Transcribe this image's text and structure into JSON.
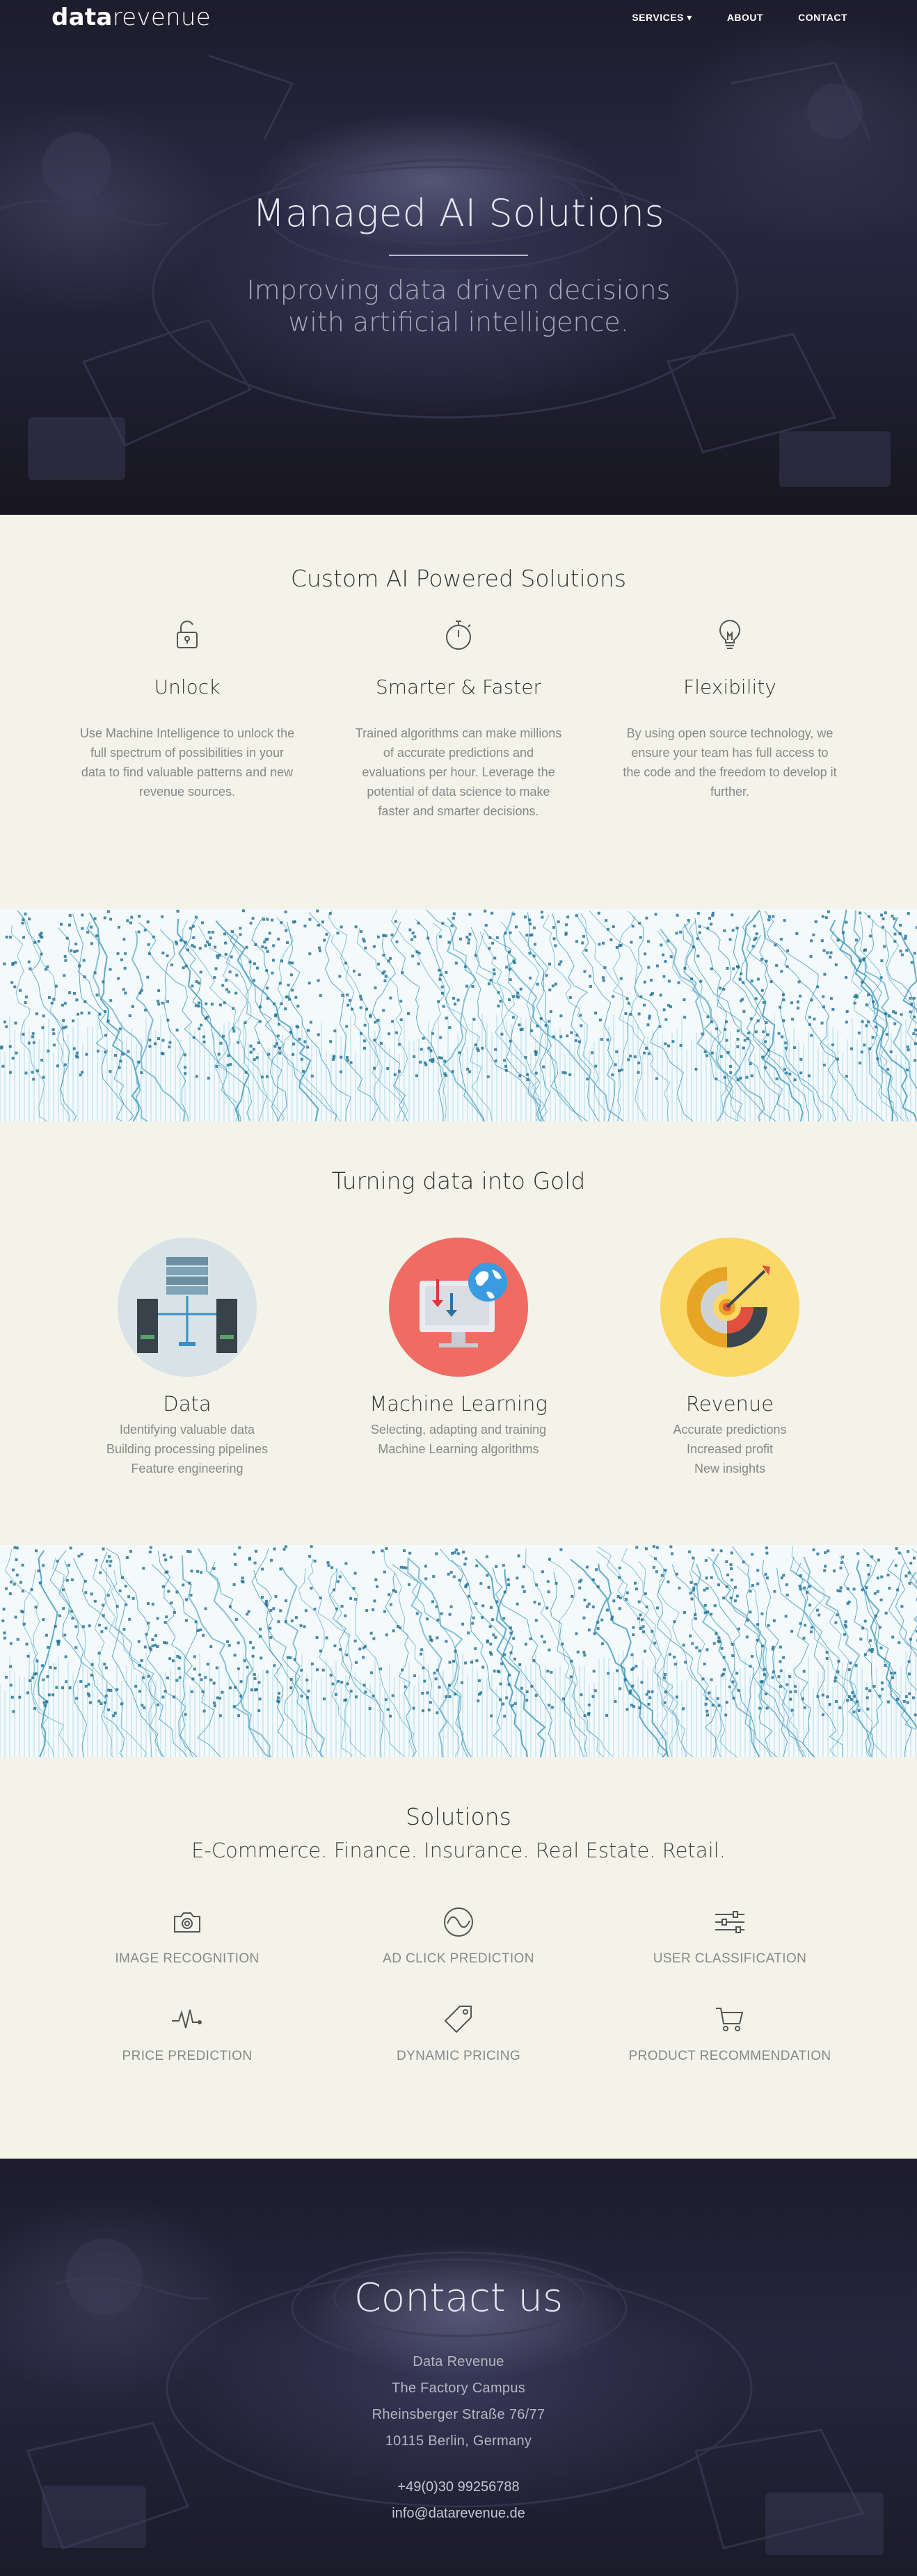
{
  "nav": {
    "logo_bold": "data",
    "logo_light": "revenue",
    "links": [
      "SERVICES ▾",
      "ABOUT",
      "CONTACT"
    ]
  },
  "hero": {
    "title": "Managed AI Solutions",
    "subtitle_line1": "Improving data driven decisions",
    "subtitle_line2": "with artificial intelligence."
  },
  "features": {
    "title": "Custom AI Powered Solutions",
    "items": [
      {
        "icon": "unlock-icon",
        "title": "Unlock",
        "text": "Use Machine Intelligence to unlock the full spectrum of possibilities in your data to find valuable patterns and new revenue sources."
      },
      {
        "icon": "stopwatch-icon",
        "title": "Smarter & Faster",
        "text": "Trained algorithms can make millions of accurate predictions and evaluations per hour. Leverage the potential of data science to make faster and smarter decisions."
      },
      {
        "icon": "lightbulb-icon",
        "title": "Flexibility",
        "text": "By using open source technology, we ensure your team has full access to the code and the freedom to develop it further."
      }
    ]
  },
  "gold": {
    "title": "Turning data into Gold",
    "items": [
      {
        "icon": "server-icon",
        "color": "#d7e3e6",
        "title": "Data",
        "lines": [
          "Identifying valuable data",
          "Building processing pipelines",
          "Feature engineering"
        ]
      },
      {
        "icon": "monitor-globe-icon",
        "color": "#f06b62",
        "title": "Machine Learning",
        "lines": [
          "Selecting, adapting and training",
          "Machine Learning algorithms"
        ]
      },
      {
        "icon": "target-icon",
        "color": "#fbd766",
        "title": "Revenue",
        "lines": [
          "Accurate predictions",
          "Increased profit",
          "New insights"
        ]
      }
    ]
  },
  "solutions": {
    "title": "Solutions",
    "subtitle": "E-Commerce. Finance. Insurance. Real Estate. Retail.",
    "items": [
      {
        "icon": "camera-icon",
        "label": "IMAGE RECOGNITION"
      },
      {
        "icon": "wave-circle-icon",
        "label": "AD CLICK PREDICTION"
      },
      {
        "icon": "sliders-icon",
        "label": "USER CLASSIFICATION"
      },
      {
        "icon": "pulse-icon",
        "label": "PRICE PREDICTION"
      },
      {
        "icon": "tag-icon",
        "label": "DYNAMIC PRICING"
      },
      {
        "icon": "cart-icon",
        "label": "PRODUCT RECOMMENDATION"
      }
    ]
  },
  "contact": {
    "title": "Contact us",
    "company": "Data Revenue",
    "building": "The Factory Campus",
    "street": "Rheinsberger Straße 76/77",
    "city": "10115 Berlin, Germany",
    "phone": "+49(0)30 99256788",
    "email": "info@datarevenue.de"
  },
  "colors": {
    "hero_bg": "#23223a",
    "page_bg": "#f3f3ea",
    "data_band": "#3a9bbf"
  }
}
